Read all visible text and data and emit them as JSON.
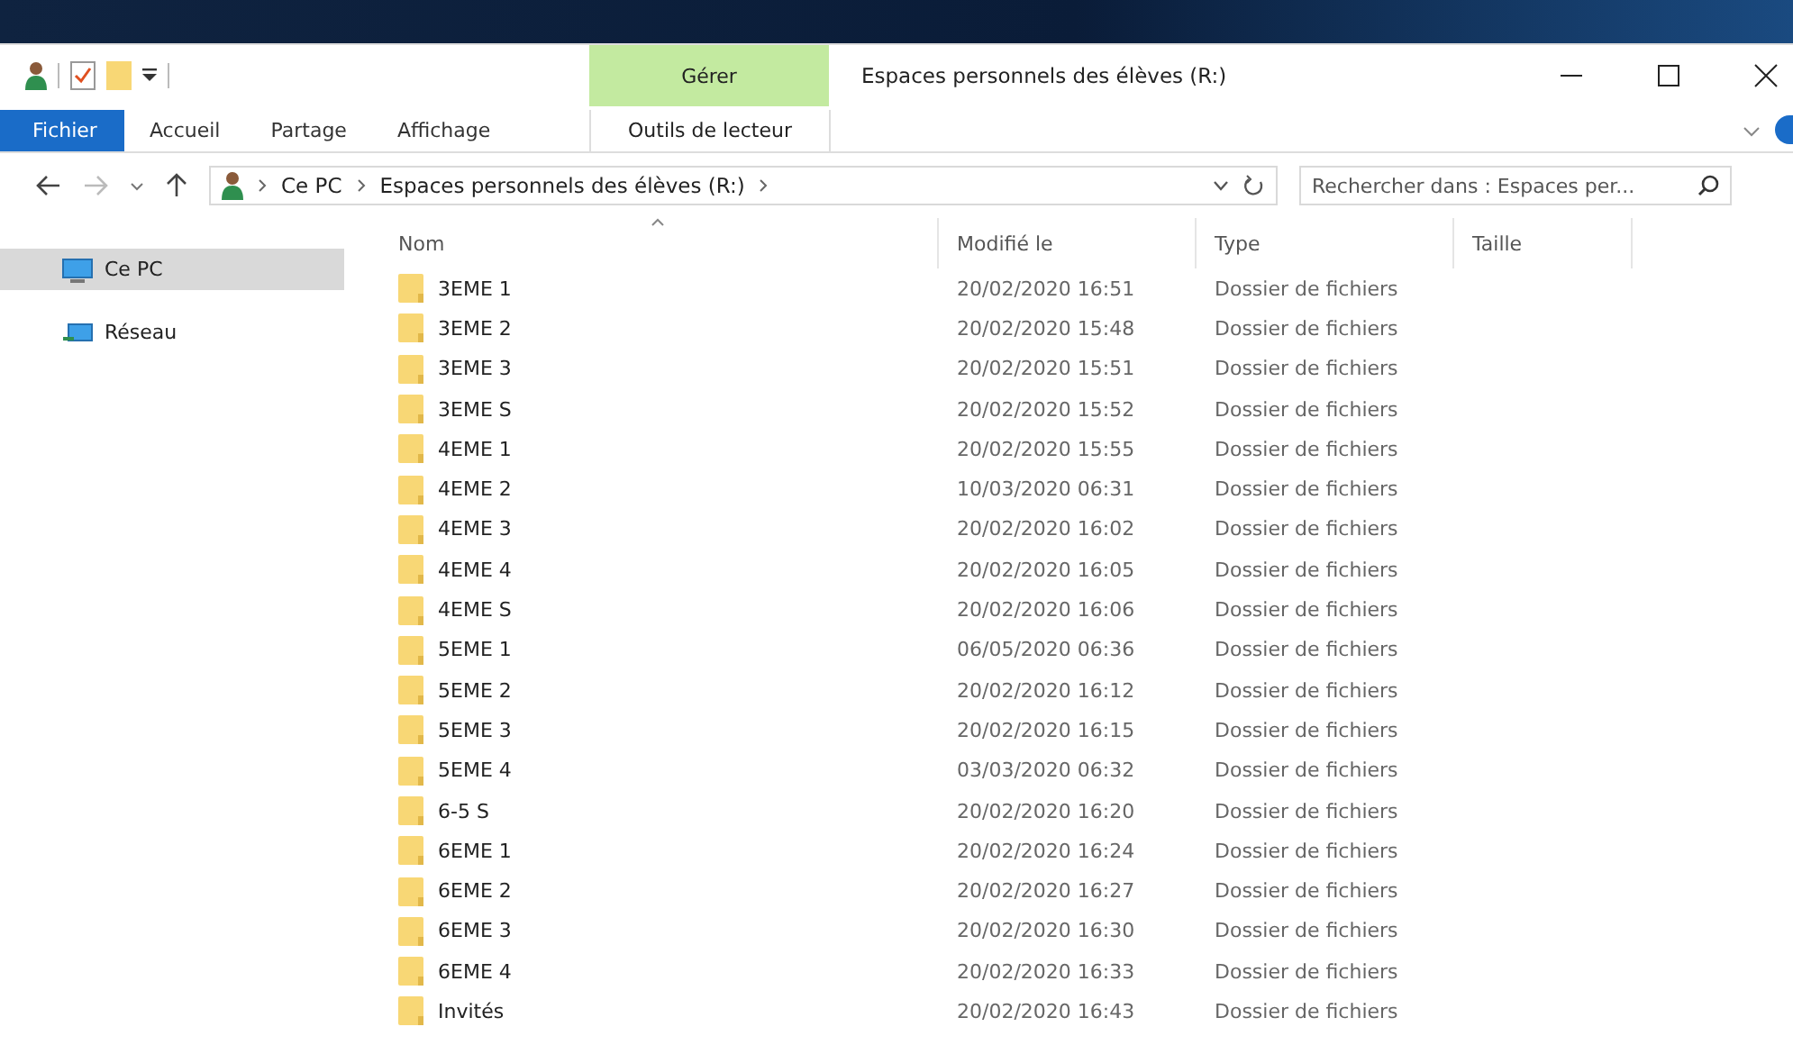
{
  "window": {
    "title": "Espaces personnels des élèves (R:)"
  },
  "context_tab": {
    "group": "Gérer",
    "label": "Outils de lecteur"
  },
  "ribbon_tabs": [
    {
      "label": "Fichier",
      "selected": true
    },
    {
      "label": "Accueil",
      "selected": false
    },
    {
      "label": "Partage",
      "selected": false
    },
    {
      "label": "Affichage",
      "selected": false
    }
  ],
  "breadcrumb": [
    "Ce PC",
    "Espaces personnels des élèves (R:)"
  ],
  "search": {
    "placeholder": "Rechercher dans : Espaces per..."
  },
  "sidebar": {
    "items": [
      {
        "label": "Ce PC",
        "kind": "pc",
        "selected": true
      },
      {
        "label": "Réseau",
        "kind": "network",
        "selected": false
      }
    ]
  },
  "table": {
    "columns": [
      "Nom",
      "Modifié le",
      "Type",
      "Taille"
    ],
    "rows": [
      {
        "name": "3EME 1",
        "modified": "20/02/2020 16:51",
        "type": "Dossier de fichiers"
      },
      {
        "name": "3EME 2",
        "modified": "20/02/2020 15:48",
        "type": "Dossier de fichiers"
      },
      {
        "name": "3EME 3",
        "modified": "20/02/2020 15:51",
        "type": "Dossier de fichiers"
      },
      {
        "name": "3EME S",
        "modified": "20/02/2020 15:52",
        "type": "Dossier de fichiers"
      },
      {
        "name": "4EME 1",
        "modified": "20/02/2020 15:55",
        "type": "Dossier de fichiers"
      },
      {
        "name": "4EME 2",
        "modified": "10/03/2020 06:31",
        "type": "Dossier de fichiers"
      },
      {
        "name": "4EME 3",
        "modified": "20/02/2020 16:02",
        "type": "Dossier de fichiers"
      },
      {
        "name": "4EME 4",
        "modified": "20/02/2020 16:05",
        "type": "Dossier de fichiers"
      },
      {
        "name": "4EME S",
        "modified": "20/02/2020 16:06",
        "type": "Dossier de fichiers"
      },
      {
        "name": "5EME 1",
        "modified": "06/05/2020 06:36",
        "type": "Dossier de fichiers"
      },
      {
        "name": "5EME 2",
        "modified": "20/02/2020 16:12",
        "type": "Dossier de fichiers"
      },
      {
        "name": "5EME 3",
        "modified": "20/02/2020 16:15",
        "type": "Dossier de fichiers"
      },
      {
        "name": "5EME 4",
        "modified": "03/03/2020 06:32",
        "type": "Dossier de fichiers"
      },
      {
        "name": "6-5 S",
        "modified": "20/02/2020 16:20",
        "type": "Dossier de fichiers"
      },
      {
        "name": "6EME 1",
        "modified": "20/02/2020 16:24",
        "type": "Dossier de fichiers"
      },
      {
        "name": "6EME 2",
        "modified": "20/02/2020 16:27",
        "type": "Dossier de fichiers"
      },
      {
        "name": "6EME 3",
        "modified": "20/02/2020 16:30",
        "type": "Dossier de fichiers"
      },
      {
        "name": "6EME 4",
        "modified": "20/02/2020 16:33",
        "type": "Dossier de fichiers"
      },
      {
        "name": "Invités",
        "modified": "20/02/2020 16:43",
        "type": "Dossier de fichiers"
      }
    ]
  }
}
